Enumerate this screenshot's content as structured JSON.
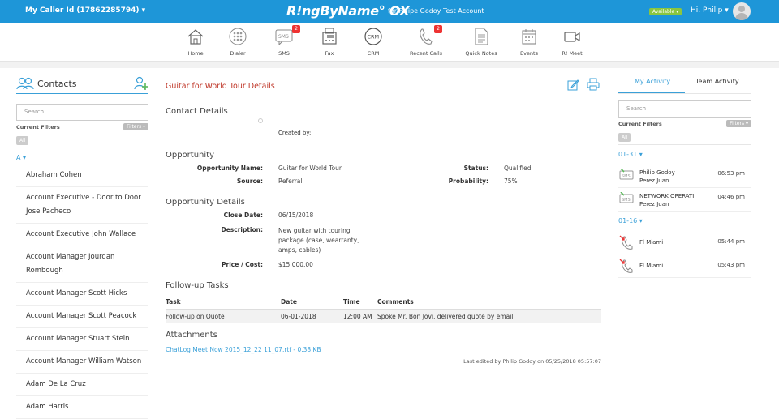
{
  "topbar": {
    "caller_id": "My Caller Id (17862285794) ▾",
    "brand": "R!ngByName° OX",
    "brand_sub": "for Felipe Godoy Test Account",
    "status": "Available ▾",
    "greeting": "Hi, Philip ▾",
    "colors": {
      "bar": "#1e96d8",
      "available": "#8bc63f"
    }
  },
  "nav": [
    {
      "label": "Home",
      "icon": "home-icon"
    },
    {
      "label": "Dialer",
      "icon": "dialpad-icon"
    },
    {
      "label": "SMS",
      "icon": "sms-icon",
      "badge": "2"
    },
    {
      "label": "Fax",
      "icon": "fax-icon"
    },
    {
      "label": "CRM",
      "icon": "crm-icon"
    },
    {
      "label": "Recent Calls",
      "icon": "phone-icon",
      "badge": "2"
    },
    {
      "label": "Quick Notes",
      "icon": "notes-icon"
    },
    {
      "label": "Events",
      "icon": "calendar-icon"
    },
    {
      "label": "R! Meet",
      "icon": "video-icon"
    }
  ],
  "contacts": {
    "title": "Contacts",
    "search_placeholder": "Search",
    "filters_label": "Current Filters",
    "filters_button": "Filters ▾",
    "all_chip": "All",
    "letter": "A ▾",
    "items": [
      "Abraham Cohen",
      "Account Executive - Door to Door Jose Pacheco",
      "Account Executive John Wallace",
      "Account Manager Jourdan Rombough",
      "Account Manager Scott Hicks",
      "Account Manager Scott Peacock",
      "Account Manager Stuart Stein",
      "Account Manager William Watson",
      "Adam De La Cruz",
      "Adam Harris"
    ]
  },
  "detail": {
    "title": "Guitar for World Tour Details",
    "contact_section": "Contact Details",
    "created_by": "Created by:",
    "opp_section": "Opportunity",
    "opp_name_label": "Opportunity Name:",
    "opp_name": "Guitar for World Tour",
    "status_label": "Status:",
    "status": "Qualified",
    "source_label": "Source:",
    "source": "Referral",
    "prob_label": "Probability:",
    "prob": "75%",
    "od_section": "Opportunity Details",
    "close_label": "Close Date:",
    "close": "06/15/2018",
    "desc_label": "Description:",
    "desc": "New guitar with touring package (case, wearranty, amps, cables)",
    "price_label": "Price / Cost:",
    "price": "$15,000.00",
    "fu_section": "Follow-up Tasks",
    "task_cols": [
      "Task",
      "Date",
      "Time",
      "Comments"
    ],
    "task_row": {
      "task": "Follow-up on Quote",
      "date": "06-01-2018",
      "time": "12:00 AM",
      "comment": "Spoke Mr. Bon Jovi, delivered quote by email."
    },
    "att_section": "Attachments",
    "attachment": "ChatLog Meet Now 2015_12_22 11_07.rtf - 0.38 KB",
    "last_edited": "Last edited by Philip Godoy on 05/25/2018 05:57:07"
  },
  "activity": {
    "tab_mine": "My Activity",
    "tab_team": "Team Activity",
    "search_placeholder": "Search",
    "filters_label": "Current Filters",
    "filters_button": "Filters ▾",
    "all_chip": "All",
    "date1": "01-31 ▾",
    "date2": "01-16 ▾",
    "items1": [
      {
        "name": "Philip Godoy",
        "sub": "Perez Juan",
        "time": "06:53 pm",
        "icon": "sms-icon"
      },
      {
        "name": "NETWORK OPERATI",
        "sub": "Perez Juan",
        "time": "04:46 pm",
        "icon": "sms-icon"
      }
    ],
    "items2": [
      {
        "name": "Fl Miami",
        "time": "05:44 pm",
        "icon": "missed-call-icon"
      },
      {
        "name": "Fl Miami",
        "time": "05:43 pm",
        "icon": "missed-call-icon"
      }
    ]
  }
}
